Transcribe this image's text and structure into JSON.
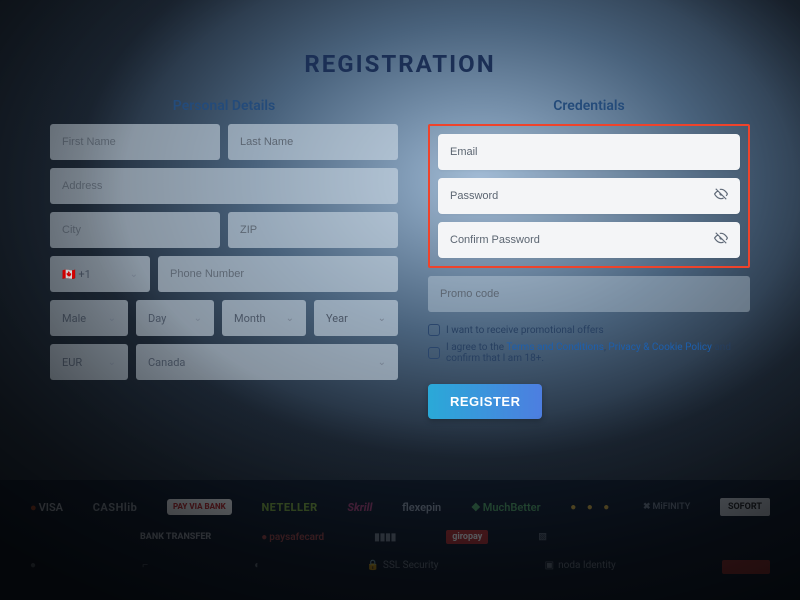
{
  "title": "REGISTRATION",
  "personal": {
    "heading": "Personal Details",
    "first_name": "First Name",
    "last_name": "Last Name",
    "address": "Address",
    "city": "City",
    "zip": "ZIP",
    "dial_code": "🇨🇦 +1",
    "phone": "Phone Number",
    "gender": "Male",
    "day": "Day",
    "month": "Month",
    "year": "Year",
    "currency": "EUR",
    "country": "Canada"
  },
  "credentials": {
    "heading": "Credentials",
    "email": "Email",
    "password": "Password",
    "confirm": "Confirm Password",
    "promo": "Promo code"
  },
  "consents": {
    "promo_offers": "I want to receive promotional offers",
    "agree_prefix": "I agree to the ",
    "terms": "Terms and Conditions",
    "sep": ", ",
    "privacy": "Privacy & Cookie Policy",
    "suffix": " and confirm that I am 18+."
  },
  "register_label": "REGISTER",
  "footer": {
    "row1": [
      "VISA",
      "CASHlib",
      "PAY VIA BANK",
      "NETELLER",
      "Skrill",
      "flexepin",
      "MuchBetter",
      "● ● ●",
      "MiFINITY",
      "SOFORT"
    ],
    "row2": [
      "BANK TRANSFER",
      "paysafecard",
      "giropay"
    ],
    "row3": [
      "18+",
      "SSL Security",
      "noda Identity"
    ]
  }
}
